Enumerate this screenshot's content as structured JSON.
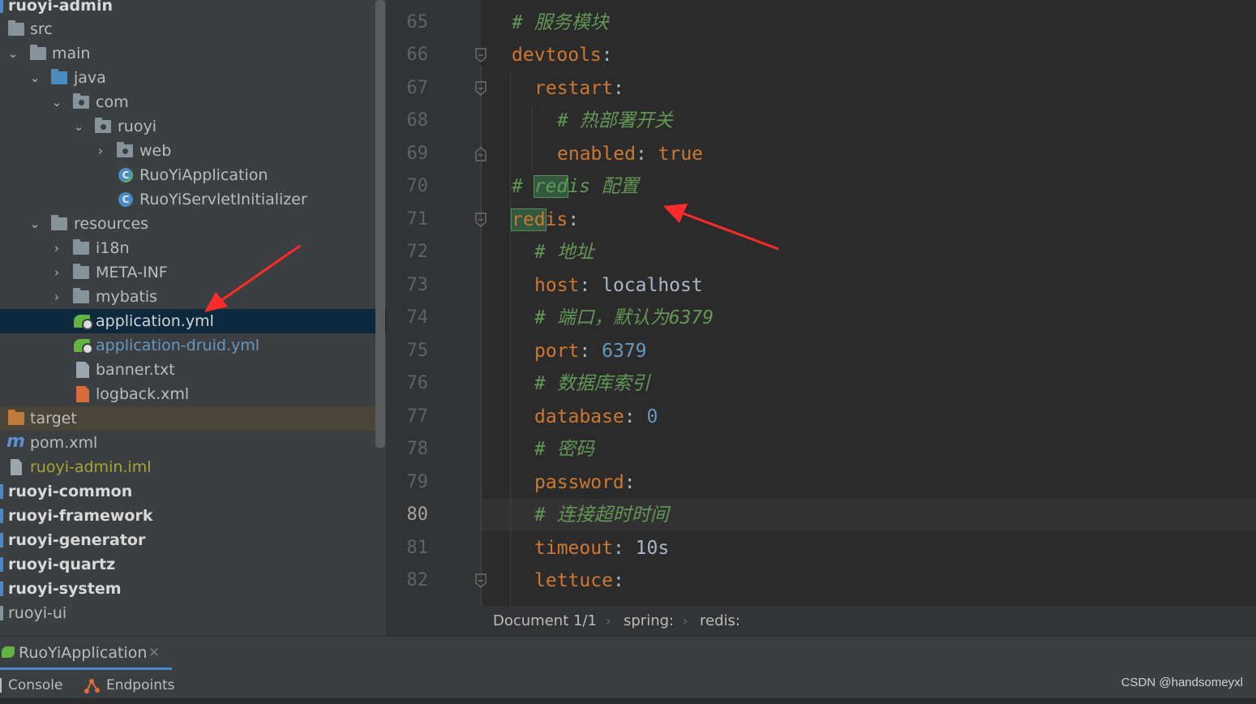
{
  "project_tree": {
    "items": [
      {
        "label": "ruoyi-admin"
      },
      {
        "label": "src"
      },
      {
        "label": "main"
      },
      {
        "label": "java"
      },
      {
        "label": "com"
      },
      {
        "label": "ruoyi"
      },
      {
        "label": "web"
      },
      {
        "label": "RuoYiApplication"
      },
      {
        "label": "RuoYiServletInitializer"
      },
      {
        "label": "resources"
      },
      {
        "label": "i18n"
      },
      {
        "label": "META-INF"
      },
      {
        "label": "mybatis"
      },
      {
        "label": "application.yml"
      },
      {
        "label": "application-druid.yml"
      },
      {
        "label": "banner.txt"
      },
      {
        "label": "logback.xml"
      },
      {
        "label": "target"
      },
      {
        "label": "pom.xml"
      },
      {
        "label": "ruoyi-admin.iml"
      },
      {
        "label": "ruoyi-common"
      },
      {
        "label": "ruoyi-framework"
      },
      {
        "label": "ruoyi-generator"
      },
      {
        "label": "ruoyi-quartz"
      },
      {
        "label": "ruoyi-system"
      },
      {
        "label": "ruoyi-ui"
      }
    ],
    "selected": "application.yml"
  },
  "editor": {
    "lines": [
      {
        "num": "65",
        "comment": "# 服务模块"
      },
      {
        "num": "66",
        "key": "devtools",
        "colon": ":"
      },
      {
        "num": "67",
        "key": "restart",
        "colon": ":"
      },
      {
        "num": "68",
        "comment": "# 热部署开关"
      },
      {
        "num": "69",
        "key": "enabled",
        "colon": ": ",
        "value": "true"
      },
      {
        "num": "70",
        "hash": "# ",
        "hlword": "red",
        "rest": "is 配置"
      },
      {
        "num": "71",
        "hlword": "red",
        "key": "is",
        "colon": ":"
      },
      {
        "num": "72",
        "comment": "# 地址"
      },
      {
        "num": "73",
        "key": "host",
        "colon": ": ",
        "value": "localhost"
      },
      {
        "num": "74",
        "comment": "# 端口，默认为6379"
      },
      {
        "num": "75",
        "key": "port",
        "colon": ": ",
        "value": "6379"
      },
      {
        "num": "76",
        "comment": "# 数据库索引"
      },
      {
        "num": "77",
        "key": "database",
        "colon": ": ",
        "value": "0"
      },
      {
        "num": "78",
        "comment": "# 密码"
      },
      {
        "num": "79",
        "key": "password",
        "colon": ":"
      },
      {
        "num": "80",
        "comment": "# 连接超时时间"
      },
      {
        "num": "81",
        "key": "timeout",
        "colon": ": ",
        "value": "10s"
      },
      {
        "num": "82",
        "key": "lettuce",
        "colon": ":"
      }
    ],
    "active_line": "80"
  },
  "breadcrumb": {
    "document": "Document 1/1",
    "items": [
      "spring:",
      "redis:"
    ]
  },
  "run_panel": {
    "config_tab": "RuoYiApplication",
    "tabs": [
      "Console",
      "Endpoints"
    ]
  },
  "watermark": "CSDN @handsomeyxl",
  "colors": {
    "yaml_key": "#cc7832",
    "comment": "#629755",
    "number": "#6897bb",
    "selection": "#0d293e",
    "annotation_arrow": "#ff2a2a"
  }
}
